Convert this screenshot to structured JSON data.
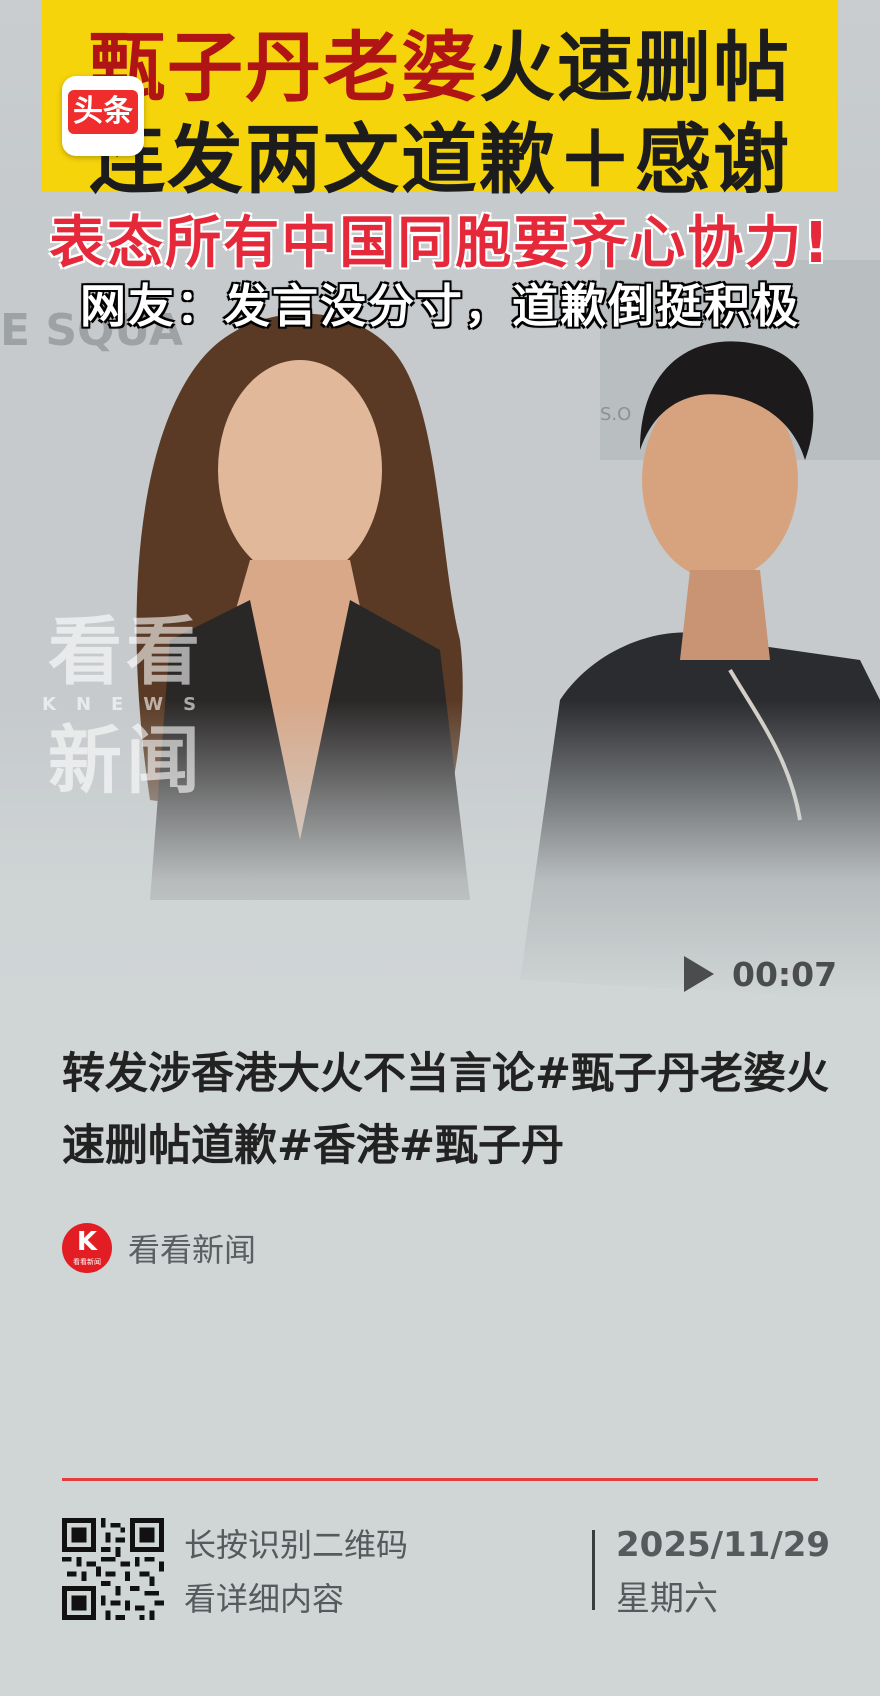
{
  "banner": {
    "app_badge": "头条",
    "line1_red": "甄子丹老婆",
    "line1_dark": "火速删帖",
    "line2": "连发两文道歉＋感谢",
    "line3": "表态所有中国同胞要齐心协力!",
    "line4": "网友：发言没分寸，道歉倒挺积极"
  },
  "watermark": {
    "top": "看看",
    "middle": "KNEWS",
    "bottom": "新闻"
  },
  "video": {
    "duration": "00:07"
  },
  "article": {
    "headline": "转发涉香港大火不当言论#甄子丹老婆火速删帖道歉#香港#甄子丹",
    "source_logo_text": "K",
    "source_logo_sub": "看看新闻",
    "source_name": "看看新闻"
  },
  "footer": {
    "qr_line1": "长按识别二维码",
    "qr_line2": "看详细内容",
    "date": "2025/11/29",
    "weekday": "星期六"
  },
  "colors": {
    "banner_yellow": "#f6d40b",
    "banner_red": "#b11414",
    "accent_red": "#e63b3b",
    "page_bg": "#d0d5d6"
  }
}
